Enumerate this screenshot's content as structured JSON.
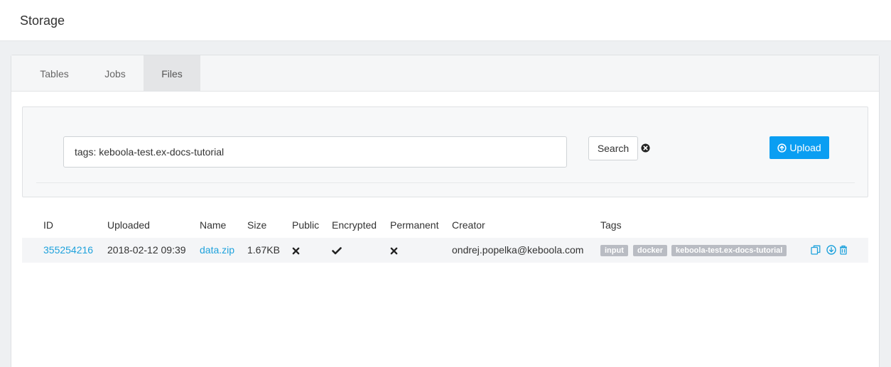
{
  "header": {
    "title": "Storage"
  },
  "tabs": [
    {
      "label": "Tables",
      "active": false
    },
    {
      "label": "Jobs",
      "active": false
    },
    {
      "label": "Files",
      "active": true
    }
  ],
  "search": {
    "value": "tags: keboola-test.ex-docs-tutorial",
    "button_label": "Search",
    "clear_icon": "times-circle-icon"
  },
  "upload": {
    "label": "Upload",
    "icon": "arrow-circle-up-icon"
  },
  "table": {
    "columns": [
      "ID",
      "Uploaded",
      "Name",
      "Size",
      "Public",
      "Encrypted",
      "Permanent",
      "Creator",
      "Tags"
    ],
    "rows": [
      {
        "id": "355254216",
        "uploaded": "2018-02-12 09:39",
        "name": "data.zip",
        "size": "1.67KB",
        "public": false,
        "encrypted": true,
        "permanent": false,
        "creator": "ondrej.popelka@keboola.com",
        "tags": [
          "input",
          "docker",
          "keboola-test.ex-docs-tutorial"
        ]
      }
    ]
  },
  "colors": {
    "accent": "#0a9ef2",
    "link": "#1fa2dc",
    "tag": "#b9bcc3"
  }
}
